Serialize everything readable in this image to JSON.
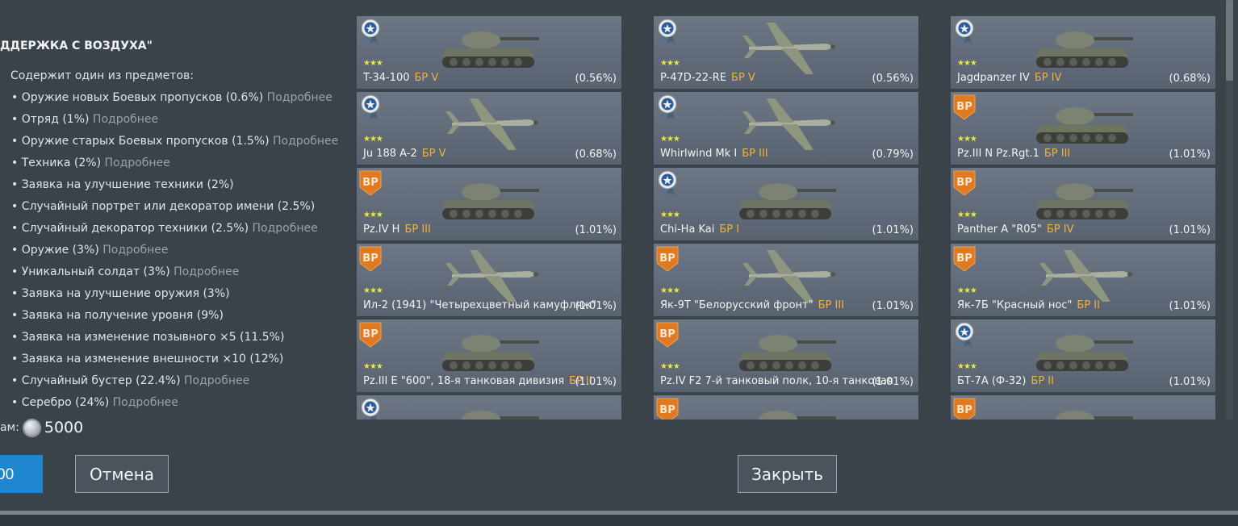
{
  "title": "ДДЕРЖКА С ВОЗДУХА\"",
  "contains_label": "Содержит один из предметов:",
  "items": [
    {
      "text": "• Оружие новых Боевых пропусков (0.6%)",
      "more": "Подробнее"
    },
    {
      "text": "• Отряд (1%)",
      "more": "Подробнее"
    },
    {
      "text": "• Оружие старых Боевых пропусков (1.5%)",
      "more": "Подробнее"
    },
    {
      "text": "• Техника (2%)",
      "more": "Подробнее"
    },
    {
      "text": "• Заявка на улучшение техники (2%)",
      "more": ""
    },
    {
      "text": "• Случайный портрет или декоратор имени (2.5%)",
      "more": ""
    },
    {
      "text": "• Случайный декоратор техники (2.5%)",
      "more": "Подробнее"
    },
    {
      "text": "• Оружие (3%)",
      "more": "Подробнее"
    },
    {
      "text": "• Уникальный солдат (3%)",
      "more": "Подробнее"
    },
    {
      "text": "• Заявка на улучшение оружия (3%)",
      "more": ""
    },
    {
      "text": "• Заявка на получение уровня (9%)",
      "more": ""
    },
    {
      "text": "• Заявка на изменение позывного ×5 (11.5%)",
      "more": ""
    },
    {
      "text": "• Заявка на изменение внешности ×10 (12%)",
      "more": ""
    },
    {
      "text": "• Случайный бустер (22.4%)",
      "more": "Подробнее"
    },
    {
      "text": "• Серебро (24%)",
      "more": "Подробнее"
    }
  ],
  "cost_label": "ам:",
  "cost_value": "5000",
  "buy_label": "00",
  "cancel_label": "Отмена",
  "close_label": "Закрыть",
  "stars": "★★★",
  "cards": [
    {
      "name": "T-34-100",
      "br": "БР V",
      "pct": "(0.56%)",
      "badge": "medal",
      "art": "tank"
    },
    {
      "name": "P-47D-22-RE",
      "br": "БР V",
      "pct": "(0.56%)",
      "badge": "medal",
      "art": "plane"
    },
    {
      "name": "Jagdpanzer IV",
      "br": "БР IV",
      "pct": "(0.68%)",
      "badge": "medal",
      "art": "tank"
    },
    {
      "name": "Ju 188 A-2",
      "br": "БР V",
      "pct": "(0.68%)",
      "badge": "medal",
      "art": "plane"
    },
    {
      "name": "Whirlwind Mk I",
      "br": "БР III",
      "pct": "(0.79%)",
      "badge": "medal",
      "art": "plane"
    },
    {
      "name": "Pz.III N Pz.Rgt.1",
      "br": "БР III",
      "pct": "(1.01%)",
      "badge": "bp",
      "art": "tank"
    },
    {
      "name": "Pz.IV H",
      "br": "БР III",
      "pct": "(1.01%)",
      "badge": "bp",
      "art": "tank"
    },
    {
      "name": "Chi-Ha Kai",
      "br": "БР I",
      "pct": "(1.01%)",
      "badge": "medal",
      "art": "tank"
    },
    {
      "name": "Panther A \"R05\"",
      "br": "БР IV",
      "pct": "(1.01%)",
      "badge": "bp",
      "art": "tank"
    },
    {
      "name": "Ил-2 (1941) \"Четырехцветный камуфляж\"",
      "br": "",
      "pct": "(1.01%)",
      "badge": "bp",
      "art": "plane"
    },
    {
      "name": "Як-9Т \"Белорусский фронт\"",
      "br": "БР III",
      "pct": "(1.01%)",
      "badge": "bp",
      "art": "plane"
    },
    {
      "name": "Як-7Б \"Красный нос\"",
      "br": "БР II",
      "pct": "(1.01%)",
      "badge": "bp",
      "art": "plane"
    },
    {
      "name": "Pz.III E \"600\", 18-я танковая дивизия",
      "br": "БР II",
      "pct": "(1.01%)",
      "badge": "bp",
      "art": "tank"
    },
    {
      "name": "Pz.IV F2 7-й танковый полк, 10-я танковая",
      "br": "",
      "pct": "(1.01%)",
      "badge": "bp",
      "art": "tank"
    },
    {
      "name": "БТ-7А (Ф-32)",
      "br": "БР II",
      "pct": "(1.01%)",
      "badge": "medal",
      "art": "tank"
    },
    {
      "name": "",
      "br": "",
      "pct": "",
      "badge": "medal",
      "art": "tank"
    },
    {
      "name": "",
      "br": "",
      "pct": "",
      "badge": "bp",
      "art": "tank"
    },
    {
      "name": "",
      "br": "",
      "pct": "",
      "badge": "bp",
      "art": "tank"
    }
  ]
}
